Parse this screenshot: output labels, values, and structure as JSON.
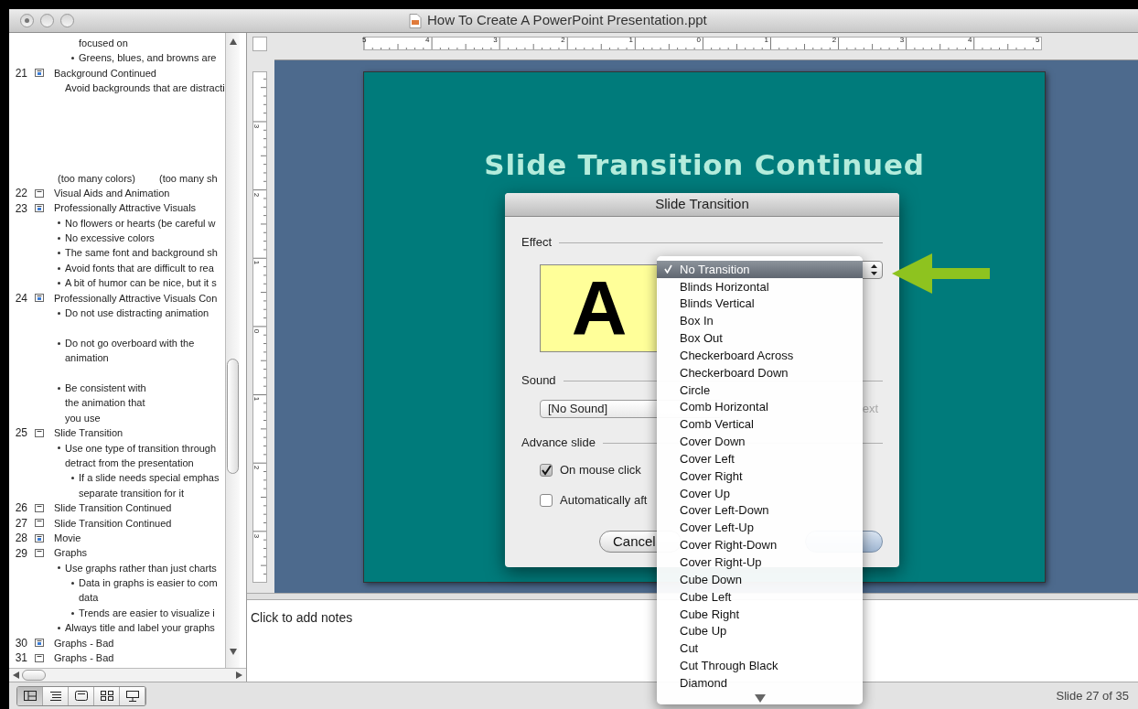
{
  "window": {
    "title": "How To Create A PowerPoint Presentation.ppt"
  },
  "outline": {
    "leading": [
      {
        "kind": "plain",
        "lines": [
          "focused on"
        ]
      },
      {
        "kind": "bullet",
        "lines": [
          "Greens, blues, and browns are"
        ]
      }
    ],
    "slides": [
      {
        "number": "21",
        "kind": "picture",
        "title": "Background Continued",
        "lines": [
          {
            "kind": "plain",
            "lines": [
              "Avoid backgrounds that are distracti"
            ]
          },
          {
            "kind": "tall_blank"
          },
          {
            "kind": "pair",
            "texts": [
              "(too many colors)",
              "(too many sh"
            ]
          }
        ]
      },
      {
        "number": "22",
        "kind": "text",
        "title": "Visual Aids and Animation"
      },
      {
        "number": "23",
        "kind": "picture",
        "title": "Professionally Attractive Visuals",
        "lines": [
          {
            "kind": "bullet",
            "lines": [
              "No flowers or hearts (be careful w"
            ]
          },
          {
            "kind": "bullet",
            "lines": [
              "No excessive colors"
            ]
          },
          {
            "kind": "bullet",
            "lines": [
              "The same font and background sh"
            ]
          },
          {
            "kind": "bullet",
            "lines": [
              "Avoid fonts that are difficult to rea"
            ]
          },
          {
            "kind": "bullet",
            "lines": [
              "A bit of humor can be nice, but it s"
            ]
          }
        ]
      },
      {
        "number": "24",
        "kind": "picture",
        "title": "Professionally Attractive Visuals Con",
        "lines": [
          {
            "kind": "bullet",
            "lines": [
              "Do not use distracting animation"
            ]
          },
          {
            "kind": "blank"
          },
          {
            "kind": "bullet",
            "lines": [
              "Do not go overboard with the",
              "animation"
            ]
          },
          {
            "kind": "blank"
          },
          {
            "kind": "bullet",
            "lines": [
              "Be consistent with",
              "the animation that",
              "you use"
            ]
          }
        ]
      },
      {
        "number": "25",
        "kind": "text",
        "title": "Slide Transition",
        "lines": [
          {
            "kind": "bullet",
            "lines": [
              "Use one type of transition through",
              "detract from the presentation"
            ],
            "children": [
              {
                "kind": "bullet",
                "lines": [
                  "If a slide needs special emphas",
                  "separate transition for it"
                ]
              }
            ]
          }
        ]
      },
      {
        "number": "26",
        "kind": "text",
        "title": "Slide Transition Continued"
      },
      {
        "number": "27",
        "kind": "text",
        "title": "Slide Transition Continued"
      },
      {
        "number": "28",
        "kind": "picture",
        "title": "Movie"
      },
      {
        "number": "29",
        "kind": "text",
        "title": "Graphs",
        "lines": [
          {
            "kind": "bullet",
            "lines": [
              "Use graphs rather than just charts"
            ],
            "children": [
              {
                "kind": "bullet",
                "lines": [
                  "Data in graphs is easier to com",
                  "data"
                ]
              },
              {
                "kind": "bullet",
                "lines": [
                  "Trends are easier to visualize i"
                ]
              }
            ]
          },
          {
            "kind": "bullet",
            "lines": [
              "Always title and label your graphs"
            ]
          }
        ]
      },
      {
        "number": "30",
        "kind": "picture",
        "title": "Graphs - Bad"
      },
      {
        "number": "31",
        "kind": "text",
        "title": "Graphs - Bad"
      }
    ]
  },
  "rulers": {
    "horizontal": [
      "5",
      "4",
      "3",
      "2",
      "1",
      "0",
      "1",
      "2",
      "3",
      "4",
      "5"
    ],
    "vertical": [
      "3",
      "2",
      "1",
      "0",
      "1",
      "2",
      "3"
    ]
  },
  "slide": {
    "title": "Slide Transition Continued"
  },
  "notes": {
    "placeholder": "Click to add notes"
  },
  "dialog": {
    "title": "Slide Transition",
    "effect_label": "Effect",
    "preview_letter": "A",
    "sound_label": "Sound",
    "sound_value": "[No Sound]",
    "sound_option_partial": "ext",
    "advance_label": "Advance slide",
    "advance_options": [
      {
        "label": "On mouse click",
        "checked": true
      },
      {
        "label": "Automatically aft",
        "checked": false
      }
    ],
    "cancel_button": "Cancel"
  },
  "transition_menu": {
    "items": [
      {
        "label": "No Transition",
        "selected": true
      },
      {
        "label": "Blinds Horizontal",
        "selected": false
      },
      {
        "label": "Blinds Vertical",
        "selected": false
      },
      {
        "label": "Box In",
        "selected": false
      },
      {
        "label": "Box Out",
        "selected": false
      },
      {
        "label": "Checkerboard Across",
        "selected": false
      },
      {
        "label": "Checkerboard Down",
        "selected": false
      },
      {
        "label": "Circle",
        "selected": false
      },
      {
        "label": "Comb Horizontal",
        "selected": false
      },
      {
        "label": "Comb Vertical",
        "selected": false
      },
      {
        "label": "Cover Down",
        "selected": false
      },
      {
        "label": "Cover Left",
        "selected": false
      },
      {
        "label": "Cover Right",
        "selected": false
      },
      {
        "label": "Cover Up",
        "selected": false
      },
      {
        "label": "Cover Left-Down",
        "selected": false
      },
      {
        "label": "Cover Left-Up",
        "selected": false
      },
      {
        "label": "Cover Right-Down",
        "selected": false
      },
      {
        "label": "Cover Right-Up",
        "selected": false
      },
      {
        "label": "Cube Down",
        "selected": false
      },
      {
        "label": "Cube Left",
        "selected": false
      },
      {
        "label": "Cube Right",
        "selected": false
      },
      {
        "label": "Cube Up",
        "selected": false
      },
      {
        "label": "Cut",
        "selected": false
      },
      {
        "label": "Cut Through Black",
        "selected": false
      },
      {
        "label": "Diamond",
        "selected": false
      }
    ]
  },
  "view_buttons": [
    {
      "kind": "normal",
      "selected": true
    },
    {
      "kind": "outline",
      "selected": false
    },
    {
      "kind": "slide",
      "selected": false
    },
    {
      "kind": "sorter",
      "selected": false
    },
    {
      "kind": "show",
      "selected": false
    }
  ],
  "status_bar": {
    "text": "Slide 27 of 35"
  }
}
